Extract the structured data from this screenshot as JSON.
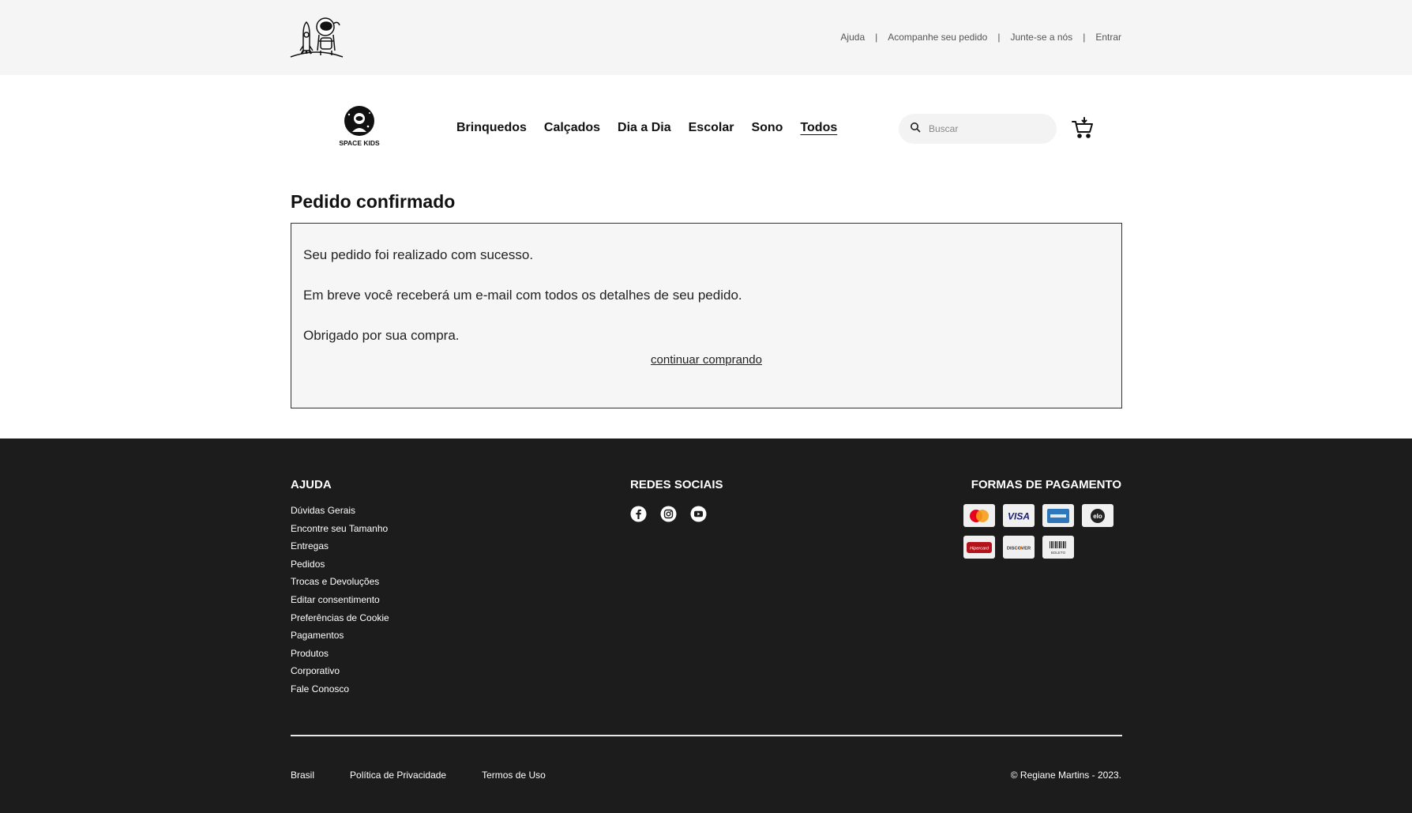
{
  "topbar": {
    "links": [
      "Ajuda",
      "Acompanhe seu pedido",
      "Junte-se a nós",
      "Entrar"
    ],
    "separator": "|"
  },
  "brand": {
    "name": "SPACE KIDS"
  },
  "nav": {
    "items": [
      "Brinquedos",
      "Calçados",
      "Dia a Dia",
      "Escolar",
      "Sono",
      "Todos"
    ],
    "active": "Todos"
  },
  "search": {
    "placeholder": "Buscar",
    "value": ""
  },
  "main": {
    "title": "Pedido confirmado",
    "messages": [
      "Seu pedido foi realizado com sucesso.",
      "Em breve você receberá um e-mail com todos os detalhes de seu pedido.",
      "Obrigado por sua compra."
    ],
    "continue_label": "continuar comprando"
  },
  "footer": {
    "help_title": "AJUDA",
    "help_links": [
      "Dúvidas Gerais",
      "Encontre seu Tamanho",
      "Entregas",
      "Pedidos",
      "Trocas e Devoluções",
      "Editar consentimento",
      "Preferências de Cookie",
      "Pagamentos",
      "Produtos",
      "Corporativo",
      "Fale Conosco"
    ],
    "social_title": "REDES SOCIAIS",
    "social_icons": [
      "facebook-icon",
      "instagram-icon",
      "youtube-icon"
    ],
    "payment_title": "FORMAS DE PAGAMENTO",
    "payment_methods": [
      "Mastercard",
      "VISA",
      "American Express",
      "elo",
      "Hipercard",
      "DISCOVER",
      "BOLETO"
    ],
    "bottom_links": [
      "Brasil",
      "Política de Privacidade",
      "Termos de Uso"
    ],
    "copyright": "© Regiane Martins - 2023."
  },
  "colors": {
    "topbar_bg": "#f5f5f5",
    "footer_bg": "#1c1c1c",
    "box_bg": "#f6f6f6",
    "mastercard_red": "#eb001b",
    "mastercard_orange": "#f79e1b",
    "visa_blue": "#1a1f71",
    "amex_blue": "#2e77bc",
    "hipercard_red": "#b3131b"
  }
}
